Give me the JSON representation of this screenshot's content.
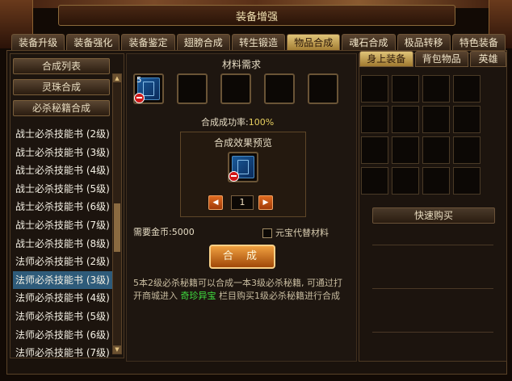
{
  "window": {
    "title": "装备增强"
  },
  "tabs": [
    {
      "label": "装备升级"
    },
    {
      "label": "装备强化"
    },
    {
      "label": "装备鉴定"
    },
    {
      "label": "翅膀合成"
    },
    {
      "label": "转生锻造"
    },
    {
      "label": "物品合成"
    },
    {
      "label": "魂石合成"
    },
    {
      "label": "极品转移"
    },
    {
      "label": "特色装备"
    }
  ],
  "active_tab": "物品合成",
  "left": {
    "header": "合成列表",
    "categories": [
      {
        "label": "灵珠合成"
      },
      {
        "label": "必杀秘籍合成"
      }
    ],
    "items": [
      {
        "label": "战士必杀技能书 (2级)"
      },
      {
        "label": "战士必杀技能书 (3级)"
      },
      {
        "label": "战士必杀技能书 (4级)"
      },
      {
        "label": "战士必杀技能书 (5级)"
      },
      {
        "label": "战士必杀技能书 (6级)"
      },
      {
        "label": "战士必杀技能书 (7级)"
      },
      {
        "label": "战士必杀技能书 (8级)"
      },
      {
        "label": "法师必杀技能书 (2级)"
      },
      {
        "label": "法师必杀技能书 (3级)"
      },
      {
        "label": "法师必杀技能书 (4级)"
      },
      {
        "label": "法师必杀技能书 (5级)"
      },
      {
        "label": "法师必杀技能书 (6级)"
      },
      {
        "label": "法师必杀技能书 (7级)"
      }
    ],
    "selected_item": "法师必杀技能书 (3级)"
  },
  "center": {
    "materials_title": "材料需求",
    "material_slot_count_label": "5",
    "success_rate_label": "合成成功率:",
    "success_rate_value": "100%",
    "preview_title": "合成效果预览",
    "quantity": "1",
    "gold_label": "需要金币:",
    "gold_value": "5000",
    "substitute_label": "元宝代替材料",
    "combine_button": "合 成",
    "desc_part1": "5本2级必杀秘籍可以合成一本3级必杀秘籍, 可通过打开商城进入 ",
    "desc_highlight": "奇珍异宝",
    "desc_part2": " 栏目购买1级必杀秘籍进行合成"
  },
  "right": {
    "tabs": [
      {
        "label": "身上装备"
      },
      {
        "label": "背包物品"
      },
      {
        "label": "英雄"
      }
    ],
    "active_tab": "身上装备",
    "quick_buy": "快速购买"
  },
  "colors": {
    "accent_gold": "#e0c478",
    "selected_row": "#2e5b7a",
    "highlight_green": "#40e040"
  }
}
